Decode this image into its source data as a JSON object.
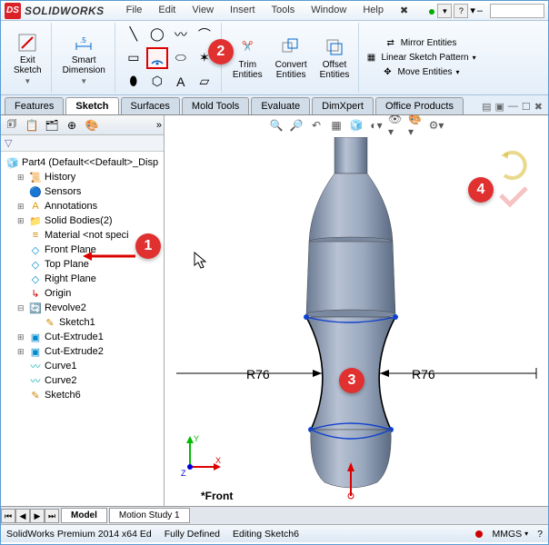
{
  "title": {
    "brand": "SOLIDWORKS"
  },
  "menubar": [
    "File",
    "Edit",
    "View",
    "Insert",
    "Tools",
    "Window",
    "Help"
  ],
  "ribbon": {
    "exit_sketch": "Exit\nSketch",
    "smart_dimension": "Smart\nDimension",
    "trim": "Trim\nEntities",
    "convert": "Convert\nEntities",
    "offset": "Offset\nEntities",
    "mirror": "Mirror Entities",
    "pattern": "Linear Sketch Pattern",
    "move": "Move Entities"
  },
  "command_tabs": [
    "Features",
    "Sketch",
    "Surfaces",
    "Mold Tools",
    "Evaluate",
    "DimXpert",
    "Office Products"
  ],
  "active_command_tab": "Sketch",
  "tree_root": "Part4  (Default<<Default>_Disp",
  "tree_items": [
    {
      "icon": "📜",
      "label": "History",
      "indent": 1,
      "exp": "+"
    },
    {
      "icon": "🔵",
      "label": "Sensors",
      "indent": 1,
      "exp": ""
    },
    {
      "icon": "📝",
      "label": "Annotations",
      "indent": 1,
      "exp": "+"
    },
    {
      "icon": "📁",
      "label": "Solid Bodies(2)",
      "indent": 1,
      "exp": "+"
    },
    {
      "icon": "≡",
      "label": "Material <not speci",
      "indent": 1,
      "exp": ""
    },
    {
      "icon": "◇",
      "label": "Front Plane",
      "indent": 1,
      "exp": ""
    },
    {
      "icon": "◇",
      "label": "Top Plane",
      "indent": 1,
      "exp": ""
    },
    {
      "icon": "◇",
      "label": "Right Plane",
      "indent": 1,
      "exp": ""
    },
    {
      "icon": "↳",
      "label": "Origin",
      "indent": 1,
      "exp": ""
    },
    {
      "icon": "🔄",
      "label": "Revolve2",
      "indent": 1,
      "exp": "-"
    },
    {
      "icon": "✎",
      "label": "Sketch1",
      "indent": 2,
      "exp": ""
    },
    {
      "icon": "▣",
      "label": "Cut-Extrude1",
      "indent": 1,
      "exp": "+"
    },
    {
      "icon": "▣",
      "label": "Cut-Extrude2",
      "indent": 1,
      "exp": "+"
    },
    {
      "icon": "〰",
      "label": "Curve1",
      "indent": 1,
      "exp": ""
    },
    {
      "icon": "〰",
      "label": "Curve2",
      "indent": 1,
      "exp": ""
    },
    {
      "icon": "✎",
      "label": "Sketch6",
      "indent": 1,
      "exp": ""
    }
  ],
  "viewport": {
    "view_label": "*Front",
    "dim_left": "R76",
    "dim_right": "R76"
  },
  "bottom_tabs": [
    "Model",
    "Motion Study 1"
  ],
  "status": {
    "app": "SolidWorks Premium 2014 x64 Ed",
    "state": "Fully Defined",
    "context": "Editing Sketch6",
    "units": "MMGS"
  },
  "callouts": {
    "c1": "1",
    "c2": "2",
    "c3": "3",
    "c4": "4"
  }
}
